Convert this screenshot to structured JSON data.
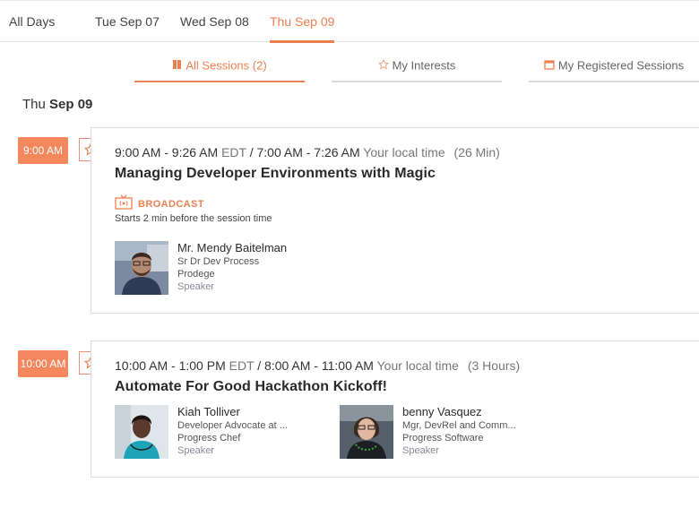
{
  "day_tabs": [
    {
      "label": "All Days",
      "active": false
    },
    {
      "label": "Tue Sep 07",
      "active": false
    },
    {
      "label": "Wed Sep 08",
      "active": false
    },
    {
      "label": "Thu Sep 09",
      "active": true
    }
  ],
  "view_tabs": [
    {
      "label": "All Sessions (2)",
      "icon": "book-icon",
      "active": true
    },
    {
      "label": "My Interests",
      "icon": "star-icon",
      "active": false
    },
    {
      "label": "My Registered Sessions",
      "icon": "calendar-icon",
      "active": false
    }
  ],
  "date_heading": {
    "prefix": "Thu",
    "day": "Sep 09"
  },
  "colors": {
    "accent": "#ee7f50",
    "badge": "#f4875e"
  },
  "sessions": [
    {
      "badge_time": "9:00 AM",
      "time_range": "9:00 AM - 9:26 AM",
      "tz": "EDT",
      "separator": "/",
      "local_range": "7:00 AM - 7:26 AM",
      "local_label": "Your local time",
      "duration": "(26 Min)",
      "title": "Managing Developer Environments with Magic",
      "broadcast_label": "BROADCAST",
      "broadcast_note": "Starts 2 min before the session time",
      "speakers": [
        {
          "name": "Mr. Mendy Baitelman",
          "title": "Sr Dr Dev Process",
          "company": "Prodege",
          "role": "Speaker"
        }
      ]
    },
    {
      "badge_time": "10:00 AM",
      "time_range": "10:00 AM - 1:00 PM",
      "tz": "EDT",
      "separator": "/",
      "local_range": "8:00 AM - 11:00 AM",
      "local_label": "Your local time",
      "duration": "(3 Hours)",
      "title": "Automate For Good Hackathon Kickoff!",
      "speakers": [
        {
          "name": "Kiah Tolliver",
          "title": "Developer Advocate at ...",
          "company": "Progress Chef",
          "role": "Speaker"
        },
        {
          "name": "benny Vasquez",
          "title": "Mgr, DevRel and Comm...",
          "company": "Progress Software",
          "role": "Speaker"
        }
      ]
    }
  ]
}
